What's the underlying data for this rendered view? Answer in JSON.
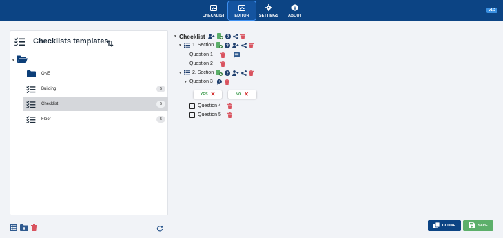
{
  "nav": {
    "items": [
      {
        "label": "CHECKLIST",
        "icon": "checklist-icon"
      },
      {
        "label": "EDITOR",
        "icon": "editor-icon"
      },
      {
        "label": "SETTINGS",
        "icon": "gear-icon"
      },
      {
        "label": "ABOUT",
        "icon": "info-icon"
      }
    ],
    "active": "EDITOR",
    "version": "v1.2"
  },
  "sidebar": {
    "title": "Checklists templates",
    "items": [
      {
        "label": "ONE",
        "icon": "folder-icon",
        "count": null
      },
      {
        "label": "Building",
        "icon": "checklist-icon",
        "count": "5"
      },
      {
        "label": "Checklist",
        "icon": "checklist-icon",
        "count": "5",
        "selected": true
      },
      {
        "label": "Floor",
        "icon": "checklist-icon",
        "count": "5"
      }
    ]
  },
  "editor": {
    "root": "Checklist",
    "section1": "1. Section",
    "q1": "Question 1",
    "q2": "Question 2",
    "section2": "2. Section",
    "q3": "Question 3",
    "yes": "YES",
    "no": "NO",
    "q4": "Question 4",
    "q5": "Question 5"
  },
  "actions": {
    "clone": "CLONE",
    "save": "SAVE"
  },
  "colors": {
    "navbar": "#0c4484",
    "accent": "#3d8ff0",
    "green": "#5caf6a",
    "red": "#d9535f",
    "clone": "#0c4484"
  }
}
